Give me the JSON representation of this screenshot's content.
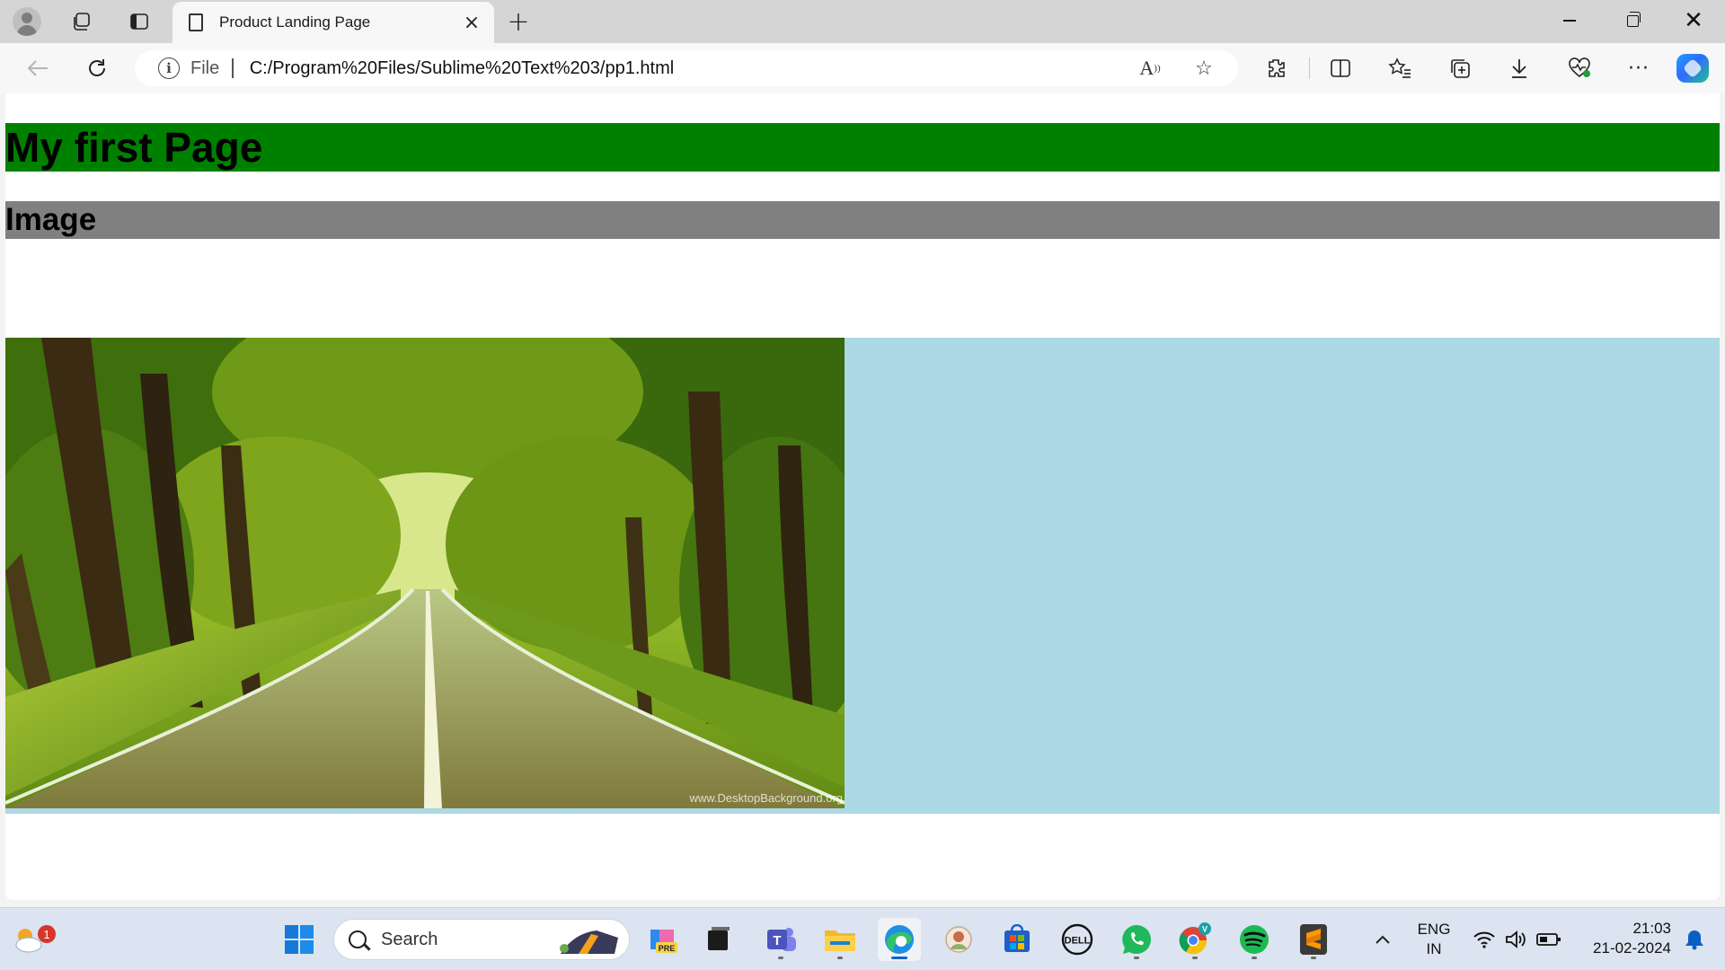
{
  "browser": {
    "tab": {
      "title": "Product Landing Page"
    },
    "address": {
      "scheme_label": "File",
      "url": "C:/Program%20Files/Sublime%20Text%203/pp1.html"
    }
  },
  "page": {
    "heading1": "My first Page",
    "heading2": "Image",
    "image_watermark": "www.DesktopBackground.org",
    "colors": {
      "heading1_bg": "#008000",
      "heading2_bg": "#808080",
      "image_section_bg": "#add8e6"
    }
  },
  "taskbar": {
    "search_placeholder": "Search",
    "weather_badge": "1",
    "language": {
      "lang": "ENG",
      "region": "IN"
    },
    "clock": {
      "time": "21:03",
      "date": "21-02-2024"
    },
    "pinned_apps": [
      "start",
      "search",
      "copilot-pre",
      "task-view",
      "teams",
      "file-explorer",
      "edge",
      "app-avatar",
      "microsoft-store",
      "dell",
      "whatsapp",
      "chrome",
      "spotify",
      "sublime-text"
    ]
  }
}
